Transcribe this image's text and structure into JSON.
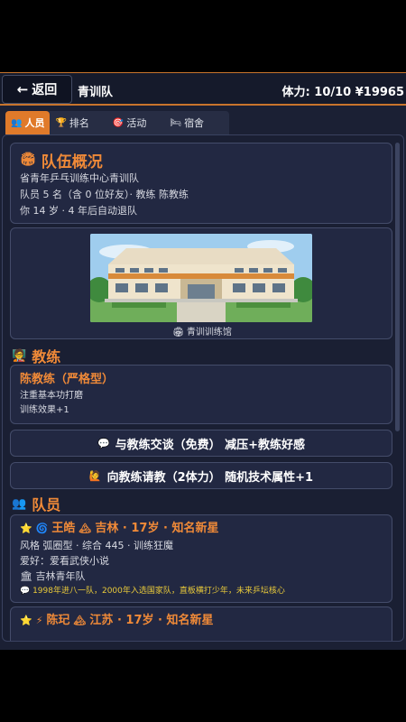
{
  "header": {
    "back_label": "返回",
    "title": "青训队",
    "stamina": "体力: 10/10 ¥19965"
  },
  "tabs": [
    {
      "icon": "👥",
      "label": "人员"
    },
    {
      "icon": "🏆",
      "label": "排名"
    },
    {
      "icon": "🎯",
      "label": "活动"
    },
    {
      "icon": "🛏",
      "label": "宿舍"
    }
  ],
  "overview": {
    "icon": "🏟",
    "title": "队伍概况",
    "lines": [
      "省青年乒乓训练中心青训队",
      "队员 5 名（含 0 位好友）· 教练 陈教练",
      "你 14 岁 · 4 年后自动退队"
    ]
  },
  "facility": {
    "caption": "🏟 青训训练馆"
  },
  "coach_section": {
    "icon": "🧑‍🏫",
    "title": "教练",
    "name": "陈教练（严格型）",
    "desc": "注重基本功打磨",
    "effect": "训练效果+1"
  },
  "actions": [
    {
      "icon": "💬",
      "label": "与教练交谈（免费） 减压+教练好感"
    },
    {
      "icon": "🙋",
      "label": "向教练请教（2体力） 随机技术属性+1"
    }
  ],
  "players_section": {
    "icon": "👥",
    "title": "队员"
  },
  "players": [
    {
      "star": "⭐",
      "style_icon": "🌀",
      "name": "王皓",
      "place_icon": "🏔",
      "info": "吉林 · 17岁 · 知名新星",
      "style_line": "风格 弧圈型 · 综合 445 · 训练狂魔",
      "hobby": "爱好：爱看武侠小说",
      "team": "🏛 吉林青年队",
      "quote": "💬 1998年进八一队，2000年入选国家队，直板横打少年，未来乒坛核心"
    },
    {
      "star": "⭐",
      "style_icon": "⚡",
      "name": "陈玘",
      "place_icon": "🏔",
      "info": "江苏 · 17岁 · 知名新星"
    }
  ]
}
